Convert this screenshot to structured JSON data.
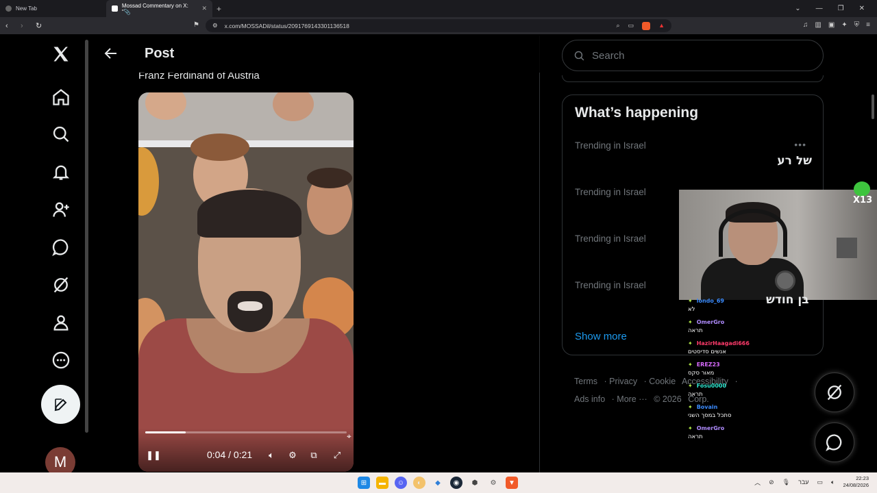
{
  "browser": {
    "tabs": [
      {
        "label": "New Tab",
        "active": false
      },
      {
        "label": "Mossad Commentary on X: \"📎",
        "active": true
      }
    ],
    "url": "x.com/MOSSADil/status/2091769143301136518"
  },
  "nav": {
    "items": [
      "x-logo",
      "home-icon",
      "search-icon",
      "notifications-icon",
      "follow-icon",
      "messages-icon",
      "grok-icon",
      "profile-icon",
      "more-icon"
    ],
    "avatar_letter": "M"
  },
  "post": {
    "header_title": "Post",
    "subtitle_text": "Franz Ferdinand of Austria",
    "video": {
      "time": "0:04 / 0:21",
      "progress": 0.2
    }
  },
  "sidebar": {
    "search_placeholder": "Search",
    "whats_happening_title": "What’s happening",
    "trends": [
      {
        "context": "Trending in Israel",
        "name": "של רע"
      },
      {
        "context": "Trending in Israel",
        "name": ""
      },
      {
        "context": "Trending in Israel",
        "name": ""
      },
      {
        "context": "Trending in Israel",
        "name": "בן חודש"
      }
    ],
    "show_more": "Show more",
    "footer": {
      "line1": [
        "Terms",
        "Privacy",
        "Cookie",
        "Accessibility"
      ],
      "line2": [
        "Ads info",
        "More ···",
        "© 2026",
        "Corp."
      ]
    }
  },
  "overlay": {
    "badge_text": "X13",
    "chat": [
      {
        "user": "londo_69",
        "color": "#3b8cff",
        "msg": "לא"
      },
      {
        "user": "OmerGro",
        "color": "#b08cff",
        "msg": "תראה"
      },
      {
        "user": "HazirHaagadi666",
        "color": "#ff3b6b",
        "msg": "אנשים סדיסטים"
      },
      {
        "user": "EREZ23",
        "color": "#d86bff",
        "msg": "מאור סקס"
      },
      {
        "user": "Fosu0000",
        "color": "#2ee6d0",
        "msg": "תראה"
      },
      {
        "user": "Bovain",
        "color": "#3b8cff",
        "msg": "סתכל במסך השני"
      },
      {
        "user": "OmerGro",
        "color": "#b08cff",
        "msg": "תראה"
      }
    ]
  },
  "taskbar": {
    "lang": "עבר",
    "time": "22:23",
    "date": "24/08/2026"
  }
}
